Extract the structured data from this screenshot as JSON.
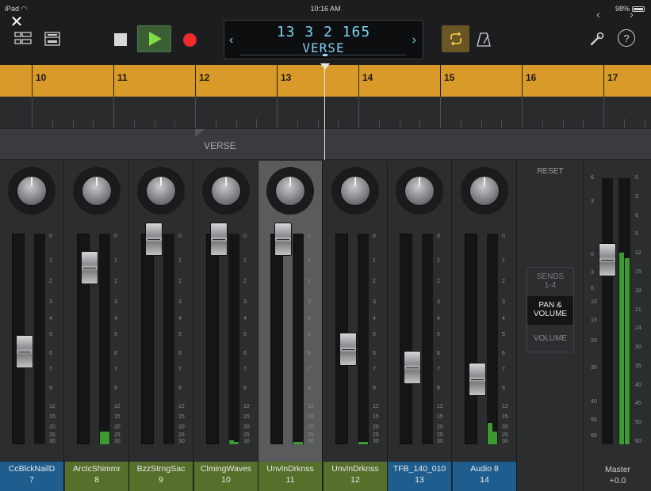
{
  "status_bar": {
    "device": "iPad",
    "time": "10:16 AM",
    "battery": "98%"
  },
  "transport": {
    "position": "13  3  2  165",
    "section": "VERSE",
    "nav_prev": "‹",
    "nav_next": "›"
  },
  "ruler": {
    "bars": [
      "10",
      "11",
      "12",
      "13",
      "14",
      "15",
      "16",
      "17"
    ]
  },
  "arrangement": {
    "marker_label": "VERSE"
  },
  "fader_scale": [
    "0",
    "1",
    "2",
    "3",
    "4",
    "5",
    "6",
    "7",
    "9",
    "12",
    "15",
    "20",
    "25",
    "30"
  ],
  "channels": [
    {
      "name": "CcBlckNailD",
      "number": "7",
      "color": "blue",
      "fader_level": 0.35,
      "meter_a": 0.0,
      "meter_b": 0.0
    },
    {
      "name": "ArctcShimmr",
      "number": "8",
      "color": "green",
      "fader_level": 0.82,
      "meter_a": 0.06,
      "meter_b": 0.06
    },
    {
      "name": "BzzStrngSac",
      "number": "9",
      "color": "green",
      "fader_level": 0.98,
      "meter_a": 0.0,
      "meter_b": 0.0
    },
    {
      "name": "ClmingWaves",
      "number": "10",
      "color": "green",
      "fader_level": 0.98,
      "meter_a": 0.02,
      "meter_b": 0.01
    },
    {
      "name": "UnvlnDrknss",
      "number": "11",
      "color": "green",
      "fader_level": 0.98,
      "meter_a": 0.01,
      "meter_b": 0.01
    },
    {
      "name": "UnvlnDrknss",
      "number": "12",
      "color": "green",
      "fader_level": 0.36,
      "meter_a": 0.01,
      "meter_b": 0.01
    },
    {
      "name": "TFB_140_010",
      "number": "13",
      "color": "blue",
      "fader_level": 0.26,
      "meter_a": 0.0,
      "meter_b": 0.0
    },
    {
      "name": "Audio 8",
      "number": "14",
      "color": "blue",
      "fader_level": 0.19,
      "meter_a": 0.1,
      "meter_b": 0.06
    }
  ],
  "selected_channel": "11",
  "side_panel": {
    "reset": "RESET",
    "sends_line1": "SENDS",
    "sends_line2": "1-4",
    "pan_line1": "PAN &",
    "pan_line2": "VOLUME",
    "volume": "VOLUME"
  },
  "master": {
    "name": "Master",
    "value": "+0.0",
    "fader_level": 0.72,
    "meter_a": 0.72,
    "meter_b": 0.7,
    "scale_left": [
      "6",
      "3",
      "0",
      "3",
      "6",
      "10",
      "15",
      "20",
      "30",
      "40",
      "50",
      "60"
    ],
    "scale_right": [
      "0",
      "3",
      "6",
      "9",
      "12",
      "15",
      "18",
      "21",
      "24",
      "30",
      "35",
      "40",
      "45",
      "50",
      "60"
    ]
  },
  "colors": {
    "ruler": "#d89b2a",
    "lcd_text": "#7fd0f2",
    "blue_plate": "#1f5d8e",
    "green_plate": "#566f2a",
    "meter": "#3d9a2f",
    "record": "#ee2a2a"
  }
}
